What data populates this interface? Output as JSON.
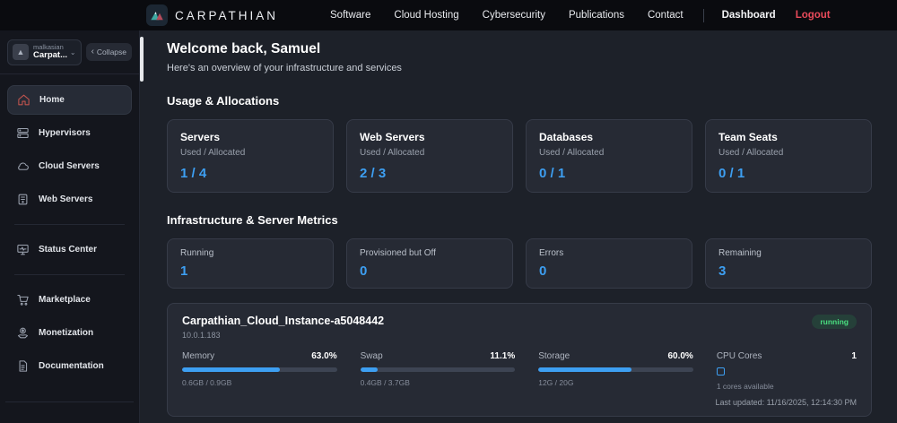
{
  "colors": {
    "accent_blue": "#3d9ff2",
    "logout_red": "#e84a5a",
    "running_green": "#4ade80",
    "home_icon_red": "#c2544e"
  },
  "topbar": {
    "brand": "CARPATHIAN",
    "nav": [
      {
        "label": "Software"
      },
      {
        "label": "Cloud Hosting"
      },
      {
        "label": "Cybersecurity"
      },
      {
        "label": "Publications"
      },
      {
        "label": "Contact"
      }
    ],
    "dashboard_label": "Dashboard",
    "logout_label": "Logout"
  },
  "sidebar": {
    "account": {
      "org_small": "malkasian",
      "org_name": "Carpat...",
      "chevron": "⌄",
      "collapse_arrow": "‹",
      "collapse_label": "Collapse"
    },
    "items": [
      {
        "label": "Home"
      },
      {
        "label": "Hypervisors"
      },
      {
        "label": "Cloud Servers"
      },
      {
        "label": "Web Servers"
      },
      {
        "label": "Status Center"
      },
      {
        "label": "Marketplace"
      },
      {
        "label": "Monetization"
      },
      {
        "label": "Documentation"
      }
    ]
  },
  "main": {
    "welcome": {
      "title": "Welcome back, Samuel",
      "subtitle": "Here's an overview of your infrastructure and services"
    },
    "usage": {
      "title": "Usage & Allocations",
      "cards": [
        {
          "title": "Servers",
          "subtitle": "Used / Allocated",
          "value": "1 / 4"
        },
        {
          "title": "Web Servers",
          "subtitle": "Used / Allocated",
          "value": "2 / 3"
        },
        {
          "title": "Databases",
          "subtitle": "Used / Allocated",
          "value": "0 / 1"
        },
        {
          "title": "Team Seats",
          "subtitle": "Used / Allocated",
          "value": "0 / 1"
        }
      ]
    },
    "metrics": {
      "title": "Infrastructure & Server Metrics",
      "cards": [
        {
          "label": "Running",
          "value": "1"
        },
        {
          "label": "Provisioned but Off",
          "value": "0"
        },
        {
          "label": "Errors",
          "value": "0"
        },
        {
          "label": "Remaining",
          "value": "3"
        }
      ]
    },
    "instance": {
      "name": "Carpathian_Cloud_Instance-a5048442",
      "ip": "10.0.1.183",
      "status": "running",
      "meters": [
        {
          "label": "Memory",
          "percent": "63.0%",
          "percent_num": 63,
          "detail": "0.6GB / 0.9GB"
        },
        {
          "label": "Swap",
          "percent": "11.1%",
          "percent_num": 11.1,
          "detail": "0.4GB / 3.7GB"
        },
        {
          "label": "Storage",
          "percent": "60.0%",
          "percent_num": 60,
          "detail": "12G / 20G"
        }
      ],
      "cpu": {
        "label": "CPU Cores",
        "value": "1",
        "detail": "1 cores available"
      },
      "last_updated": "Last updated: 11/16/2025, 12:14:30 PM"
    }
  }
}
